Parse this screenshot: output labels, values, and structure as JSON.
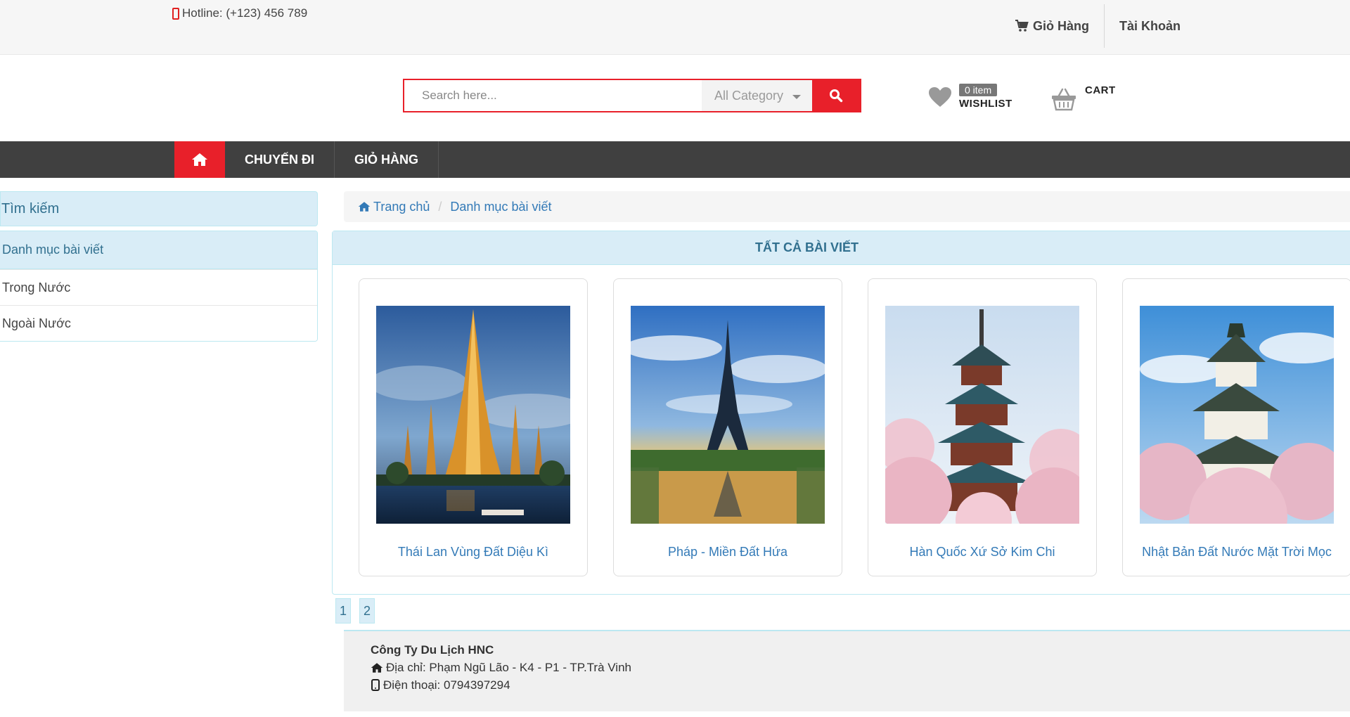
{
  "topbar": {
    "hotline": "Hotline: (+123) 456 789",
    "cart_link": "Giỏ Hàng",
    "account_link": "Tài Khoản"
  },
  "header": {
    "search_placeholder": "Search here...",
    "category": "All Category",
    "wishlist_badge": "0 item",
    "wishlist_label": "WISHLIST",
    "cart_label": "CART"
  },
  "nav": {
    "items": [
      "CHUYẾN ĐI",
      "GIỎ HÀNG"
    ]
  },
  "sidebar": {
    "search_title": "Tìm kiếm",
    "category_title": "Danh mục bài viết",
    "items": [
      "Trong Nước",
      "Ngoài Nước"
    ]
  },
  "breadcrumb": {
    "home": "Trang chủ",
    "current": "Danh mục bài viết"
  },
  "posts": {
    "title": "TẤT CẢ BÀI VIẾT",
    "items": [
      {
        "title": "Thái Lan Vùng Đất Diệu Kì"
      },
      {
        "title": "Pháp - Miền Đất Hứa"
      },
      {
        "title": "Hàn Quốc Xứ Sở Kim Chi"
      },
      {
        "title": "Nhật Bản Đất Nước Mặt Trời Mọc"
      }
    ]
  },
  "pagination": [
    "1",
    "2"
  ],
  "footer": {
    "company": "Công Ty Du Lịch HNC",
    "address": "Địa chỉ: Phạm Ngũ Lão - K4 - P1 - TP.Trà Vinh",
    "phone": "Điện thoại: 0794397294"
  },
  "colors": {
    "accent": "#e8202a",
    "nav_bg": "#404040",
    "panel_bg": "#d9edf7",
    "link": "#337ab7"
  }
}
